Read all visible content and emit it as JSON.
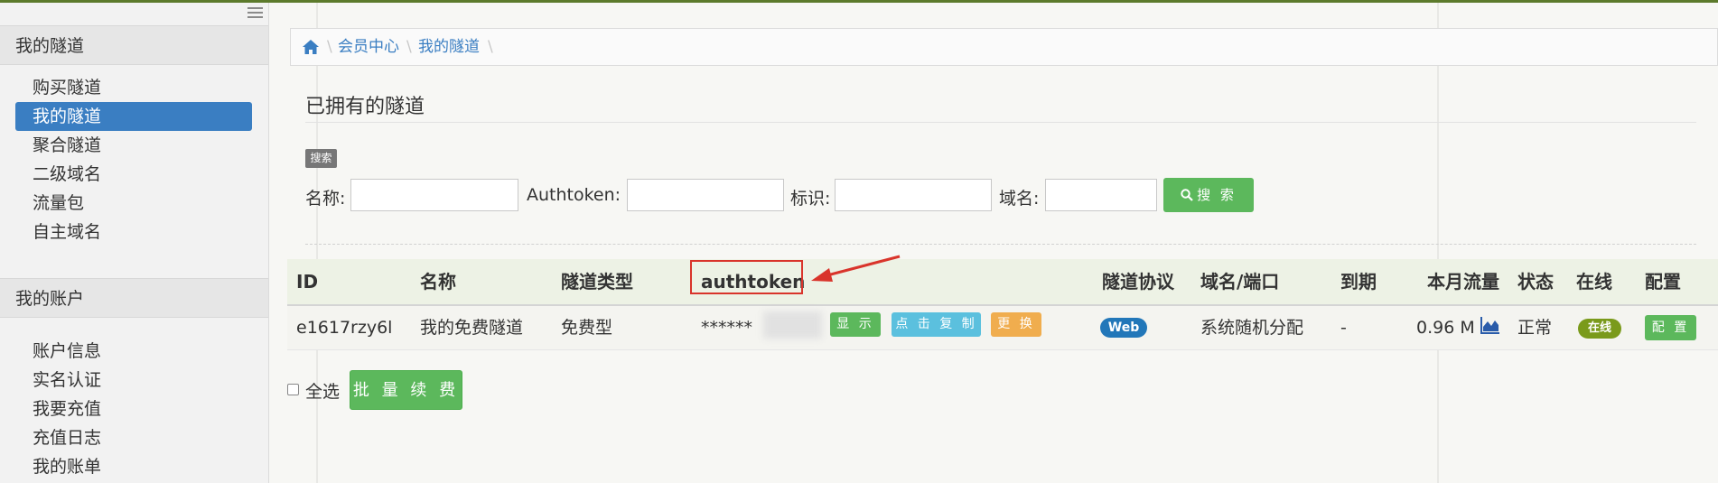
{
  "sidebar": {
    "section1_title": "我的隧道",
    "section1_items": [
      "购买隧道",
      "我的隧道",
      "聚合隧道",
      "二级域名",
      "流量包",
      "自主域名"
    ],
    "section2_title": "我的账户",
    "section2_items": [
      "账户信息",
      "实名认证",
      "我要充值",
      "充值日志",
      "我的账单"
    ],
    "active_item": "我的隧道"
  },
  "breadcrumb": {
    "items": [
      "会员中心",
      "我的隧道"
    ]
  },
  "page": {
    "title": "已拥有的隧道"
  },
  "search": {
    "badge": "搜索",
    "name_label": "名称:",
    "authtoken_label": "Authtoken:",
    "tag_label": "标识:",
    "domain_label": "域名:",
    "button_label": "搜 索"
  },
  "table": {
    "columns": [
      "ID",
      "名称",
      "隧道类型",
      "authtoken",
      "隧道协议",
      "域名/端口",
      "到期",
      "本月流量",
      "状态",
      "在线",
      "配置"
    ],
    "rows": [
      {
        "id": "e1617rzy6l",
        "name": "我的免费隧道",
        "type": "免费型",
        "authtoken_masked": "******",
        "btn_show": "显 示",
        "btn_copy": "点 击 复 制",
        "btn_change": "更 换",
        "protocol": "Web",
        "domain_port": "系统随机分配",
        "expiry": "-",
        "traffic": "0.96 M",
        "status": "正常",
        "online": "在线",
        "config": "配 置"
      }
    ]
  },
  "footer": {
    "select_all": "全选",
    "batch_renew": "批 量 续 费"
  },
  "colors": {
    "primary": "#3a7ec2",
    "success": "#5cb85c",
    "info": "#5bc0de",
    "warning": "#f0ad4e",
    "highlight": "#d9342b"
  },
  "icons": {
    "home": "home-icon",
    "search": "search-icon",
    "chart": "chart-icon",
    "menu": "menu-collapse-icon"
  }
}
